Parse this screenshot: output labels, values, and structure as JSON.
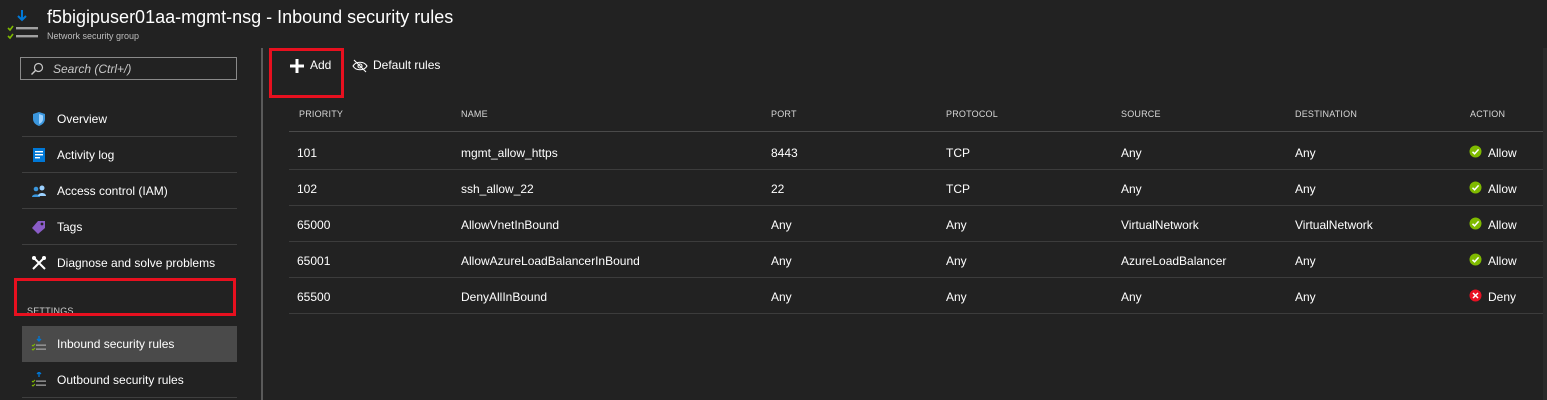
{
  "header": {
    "title": "f5bigipuser01aa-mgmt-nsg - Inbound security rules",
    "subtitle": "Network security group",
    "icon": "nsg-rules-icon"
  },
  "sidebar": {
    "search": {
      "placeholder": "Search (Ctrl+/)"
    },
    "items": [
      {
        "label": "Overview",
        "icon": "shield-icon"
      },
      {
        "label": "Activity log",
        "icon": "activity-log-icon"
      },
      {
        "label": "Access control (IAM)",
        "icon": "people-icon"
      },
      {
        "label": "Tags",
        "icon": "tag-icon"
      },
      {
        "label": "Diagnose and solve problems",
        "icon": "wrench-icon"
      }
    ],
    "settings_heading": "SETTINGS",
    "settings_items": [
      {
        "label": "Inbound security rules",
        "icon": "inbound-rules-icon",
        "active": true
      },
      {
        "label": "Outbound security rules",
        "icon": "outbound-rules-icon",
        "active": false
      }
    ]
  },
  "toolbar": {
    "add_label": "Add",
    "default_rules_label": "Default rules"
  },
  "table": {
    "columns": [
      "PRIORITY",
      "NAME",
      "PORT",
      "PROTOCOL",
      "SOURCE",
      "DESTINATION",
      "ACTION"
    ],
    "rows": [
      {
        "priority": "101",
        "name": "mgmt_allow_https",
        "port": "8443",
        "protocol": "TCP",
        "source": "Any",
        "destination": "Any",
        "action": "Allow"
      },
      {
        "priority": "102",
        "name": "ssh_allow_22",
        "port": "22",
        "protocol": "TCP",
        "source": "Any",
        "destination": "Any",
        "action": "Allow"
      },
      {
        "priority": "65000",
        "name": "AllowVnetInBound",
        "port": "Any",
        "protocol": "Any",
        "source": "VirtualNetwork",
        "destination": "VirtualNetwork",
        "action": "Allow"
      },
      {
        "priority": "65001",
        "name": "AllowAzureLoadBalancerInBound",
        "port": "Any",
        "protocol": "Any",
        "source": "AzureLoadBalancer",
        "destination": "Any",
        "action": "Allow"
      },
      {
        "priority": "65500",
        "name": "DenyAllInBound",
        "port": "Any",
        "protocol": "Any",
        "source": "Any",
        "destination": "Any",
        "action": "Deny"
      }
    ]
  },
  "colors": {
    "background": "#222222",
    "highlight": "#e8101f",
    "allow": "#7fba00",
    "deny": "#e81123",
    "accent": "#0078d7"
  }
}
